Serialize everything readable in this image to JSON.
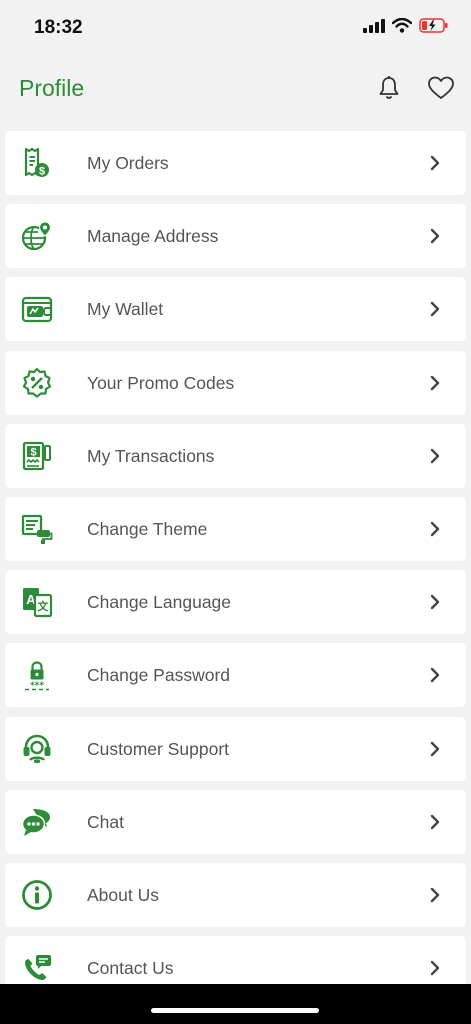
{
  "status": {
    "time": "18:32"
  },
  "header": {
    "title": "Profile"
  },
  "colors": {
    "accent": "#2e8b3a",
    "background": "#f2f2f2",
    "card": "#ffffff",
    "text": "#555555"
  },
  "menu": [
    {
      "label": "My Orders",
      "icon": "receipt-dollar-icon"
    },
    {
      "label": "Manage Address",
      "icon": "globe-pin-icon"
    },
    {
      "label": "My Wallet",
      "icon": "wallet-icon"
    },
    {
      "label": "Your Promo Codes",
      "icon": "percent-badge-icon"
    },
    {
      "label": "My Transactions",
      "icon": "transaction-receipt-icon"
    },
    {
      "label": "Change Theme",
      "icon": "paint-roller-icon"
    },
    {
      "label": "Change Language",
      "icon": "translate-icon"
    },
    {
      "label": "Change Password",
      "icon": "lock-password-icon"
    },
    {
      "label": "Customer Support",
      "icon": "headset-icon"
    },
    {
      "label": "Chat",
      "icon": "chat-bubbles-icon"
    },
    {
      "label": "About Us",
      "icon": "info-icon"
    },
    {
      "label": "Contact Us",
      "icon": "phone-message-icon"
    }
  ]
}
